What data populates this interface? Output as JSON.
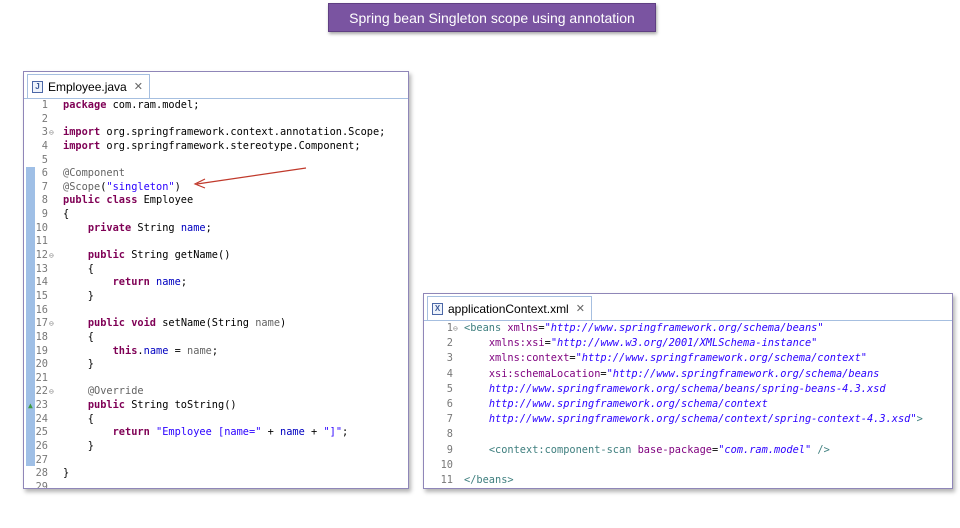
{
  "banner": {
    "title": "Spring bean Singleton scope using annotation"
  },
  "java_editor": {
    "tab_label": "Employee.java",
    "tab_icon": "J",
    "lines": [
      {
        "n": "1",
        "fold": "",
        "ovr": "",
        "tokens": [
          {
            "c": "kw",
            "t": "package"
          },
          {
            "c": "plain",
            "t": " com.ram.model;"
          }
        ]
      },
      {
        "n": "2",
        "fold": "",
        "ovr": "",
        "tokens": []
      },
      {
        "n": "3",
        "fold": "⊖",
        "ovr": "",
        "tokens": [
          {
            "c": "kw",
            "t": "import"
          },
          {
            "c": "plain",
            "t": " org.springframework.context.annotation.Scope;"
          }
        ]
      },
      {
        "n": "4",
        "fold": "",
        "ovr": "",
        "tokens": [
          {
            "c": "kw",
            "t": "import"
          },
          {
            "c": "plain",
            "t": " org.springframework.stereotype.Component;"
          }
        ]
      },
      {
        "n": "5",
        "fold": "",
        "ovr": "",
        "tokens": []
      },
      {
        "n": "6",
        "fold": "",
        "ovr": "",
        "tokens": [
          {
            "c": "ann",
            "t": "@Component"
          }
        ]
      },
      {
        "n": "7",
        "fold": "",
        "ovr": "",
        "tokens": [
          {
            "c": "ann",
            "t": "@Scope"
          },
          {
            "c": "plain",
            "t": "("
          },
          {
            "c": "str",
            "t": "\"singleton\""
          },
          {
            "c": "plain",
            "t": ")"
          }
        ]
      },
      {
        "n": "8",
        "fold": "",
        "ovr": "",
        "tokens": [
          {
            "c": "kw",
            "t": "public class"
          },
          {
            "c": "plain",
            "t": " Employee"
          }
        ]
      },
      {
        "n": "9",
        "fold": "",
        "ovr": "",
        "tokens": [
          {
            "c": "plain",
            "t": "{"
          }
        ]
      },
      {
        "n": "10",
        "fold": "",
        "ovr": "",
        "tokens": [
          {
            "c": "plain",
            "t": "    "
          },
          {
            "c": "kw",
            "t": "private"
          },
          {
            "c": "plain",
            "t": " String "
          },
          {
            "c": "fld",
            "t": "name"
          },
          {
            "c": "plain",
            "t": ";"
          }
        ]
      },
      {
        "n": "11",
        "fold": "",
        "ovr": "",
        "tokens": []
      },
      {
        "n": "12",
        "fold": "⊖",
        "ovr": "",
        "tokens": [
          {
            "c": "plain",
            "t": "    "
          },
          {
            "c": "kw",
            "t": "public"
          },
          {
            "c": "plain",
            "t": " String getName()"
          }
        ]
      },
      {
        "n": "13",
        "fold": "",
        "ovr": "",
        "tokens": [
          {
            "c": "plain",
            "t": "    {"
          }
        ]
      },
      {
        "n": "14",
        "fold": "",
        "ovr": "",
        "tokens": [
          {
            "c": "plain",
            "t": "        "
          },
          {
            "c": "kw",
            "t": "return"
          },
          {
            "c": "plain",
            "t": " "
          },
          {
            "c": "fld",
            "t": "name"
          },
          {
            "c": "plain",
            "t": ";"
          }
        ]
      },
      {
        "n": "15",
        "fold": "",
        "ovr": "",
        "tokens": [
          {
            "c": "plain",
            "t": "    }"
          }
        ]
      },
      {
        "n": "16",
        "fold": "",
        "ovr": "",
        "tokens": []
      },
      {
        "n": "17",
        "fold": "⊖",
        "ovr": "",
        "tokens": [
          {
            "c": "plain",
            "t": "    "
          },
          {
            "c": "kw",
            "t": "public void"
          },
          {
            "c": "plain",
            "t": " setName(String "
          },
          {
            "c": "ann",
            "t": "name"
          },
          {
            "c": "plain",
            "t": ")"
          }
        ]
      },
      {
        "n": "18",
        "fold": "",
        "ovr": "",
        "tokens": [
          {
            "c": "plain",
            "t": "    {"
          }
        ]
      },
      {
        "n": "19",
        "fold": "",
        "ovr": "",
        "tokens": [
          {
            "c": "plain",
            "t": "        "
          },
          {
            "c": "kw",
            "t": "this"
          },
          {
            "c": "plain",
            "t": "."
          },
          {
            "c": "fld",
            "t": "name"
          },
          {
            "c": "plain",
            "t": " = "
          },
          {
            "c": "ann",
            "t": "name"
          },
          {
            "c": "plain",
            "t": ";"
          }
        ]
      },
      {
        "n": "20",
        "fold": "",
        "ovr": "",
        "tokens": [
          {
            "c": "plain",
            "t": "    }"
          }
        ]
      },
      {
        "n": "21",
        "fold": "",
        "ovr": "",
        "tokens": []
      },
      {
        "n": "22",
        "fold": "⊖",
        "ovr": "",
        "tokens": [
          {
            "c": "plain",
            "t": "    "
          },
          {
            "c": "ann",
            "t": "@Override"
          }
        ]
      },
      {
        "n": "23",
        "fold": "",
        "ovr": "▲",
        "tokens": [
          {
            "c": "plain",
            "t": "    "
          },
          {
            "c": "kw",
            "t": "public"
          },
          {
            "c": "plain",
            "t": " String toString()"
          }
        ]
      },
      {
        "n": "24",
        "fold": "",
        "ovr": "",
        "tokens": [
          {
            "c": "plain",
            "t": "    {"
          }
        ]
      },
      {
        "n": "25",
        "fold": "",
        "ovr": "",
        "tokens": [
          {
            "c": "plain",
            "t": "        "
          },
          {
            "c": "kw",
            "t": "return"
          },
          {
            "c": "plain",
            "t": " "
          },
          {
            "c": "str",
            "t": "\"Employee [name=\""
          },
          {
            "c": "plain",
            "t": " + "
          },
          {
            "c": "fld",
            "t": "name"
          },
          {
            "c": "plain",
            "t": " + "
          },
          {
            "c": "str",
            "t": "\"]\""
          },
          {
            "c": "plain",
            "t": ";"
          }
        ]
      },
      {
        "n": "26",
        "fold": "",
        "ovr": "",
        "tokens": [
          {
            "c": "plain",
            "t": "    }"
          }
        ]
      },
      {
        "n": "27",
        "fold": "",
        "ovr": "",
        "tokens": []
      },
      {
        "n": "28",
        "fold": "",
        "ovr": "",
        "tokens": [
          {
            "c": "plain",
            "t": "}"
          }
        ]
      },
      {
        "n": "29",
        "fold": "",
        "ovr": "",
        "tokens": []
      }
    ]
  },
  "xml_editor": {
    "tab_label": "applicationContext.xml",
    "tab_icon": "X",
    "lines": [
      {
        "n": "1",
        "fold": "⊖",
        "tokens": [
          {
            "c": "tag",
            "t": "<beans "
          },
          {
            "c": "attr",
            "t": "xmlns"
          },
          {
            "c": "plain",
            "t": "="
          },
          {
            "c": "xval",
            "t": "\"http://www.springframework.org/schema/beans\""
          }
        ]
      },
      {
        "n": "2",
        "fold": "",
        "tokens": [
          {
            "c": "plain",
            "t": "    "
          },
          {
            "c": "attr",
            "t": "xmlns:xsi"
          },
          {
            "c": "plain",
            "t": "="
          },
          {
            "c": "xval",
            "t": "\"http://www.w3.org/2001/XMLSchema-instance\""
          }
        ]
      },
      {
        "n": "3",
        "fold": "",
        "tokens": [
          {
            "c": "plain",
            "t": "    "
          },
          {
            "c": "attr",
            "t": "xmlns:context"
          },
          {
            "c": "plain",
            "t": "="
          },
          {
            "c": "xval",
            "t": "\"http://www.springframework.org/schema/context\""
          }
        ]
      },
      {
        "n": "4",
        "fold": "",
        "tokens": [
          {
            "c": "plain",
            "t": "    "
          },
          {
            "c": "attr",
            "t": "xsi:schemaLocation"
          },
          {
            "c": "plain",
            "t": "="
          },
          {
            "c": "xval",
            "t": "\"http://www.springframework.org/schema/beans"
          }
        ]
      },
      {
        "n": "5",
        "fold": "",
        "tokens": [
          {
            "c": "plain",
            "t": "    "
          },
          {
            "c": "xval",
            "t": "http://www.springframework.org/schema/beans/spring-beans-4.3.xsd"
          }
        ]
      },
      {
        "n": "6",
        "fold": "",
        "tokens": [
          {
            "c": "plain",
            "t": "    "
          },
          {
            "c": "xval",
            "t": "http://www.springframework.org/schema/context"
          }
        ]
      },
      {
        "n": "7",
        "fold": "",
        "tokens": [
          {
            "c": "plain",
            "t": "    "
          },
          {
            "c": "xval",
            "t": "http://www.springframework.org/schema/context/spring-context-4.3.xsd\""
          },
          {
            "c": "tag",
            "t": ">"
          }
        ]
      },
      {
        "n": "8",
        "fold": "",
        "tokens": []
      },
      {
        "n": "9",
        "fold": "",
        "tokens": [
          {
            "c": "plain",
            "t": "    "
          },
          {
            "c": "tag",
            "t": "<context:component-scan "
          },
          {
            "c": "attr",
            "t": "base-package"
          },
          {
            "c": "plain",
            "t": "="
          },
          {
            "c": "xval",
            "t": "\"com.ram.model\""
          },
          {
            "c": "tag",
            "t": " />"
          }
        ]
      },
      {
        "n": "10",
        "fold": "",
        "tokens": []
      },
      {
        "n": "11",
        "fold": "",
        "tokens": [
          {
            "c": "tag",
            "t": "</beans>"
          }
        ]
      }
    ]
  }
}
